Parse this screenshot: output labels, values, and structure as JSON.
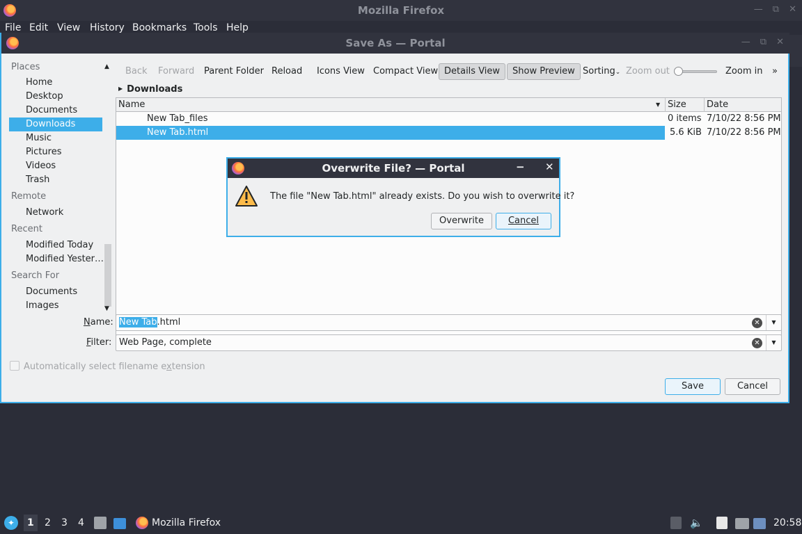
{
  "firefox": {
    "title": "Mozilla Firefox",
    "menu": [
      "File",
      "Edit",
      "View",
      "History",
      "Bookmarks",
      "Tools",
      "Help"
    ],
    "window_controls": [
      "—",
      "⧉",
      "✕"
    ]
  },
  "save_dialog": {
    "title": "Save As — Portal",
    "sidebar": {
      "groups": {
        "places": "Places",
        "remote": "Remote",
        "recent": "Recent",
        "search": "Search For"
      },
      "places_items": [
        "Home",
        "Desktop",
        "Documents",
        "Downloads",
        "Music",
        "Pictures",
        "Videos",
        "Trash"
      ],
      "remote_items": [
        "Network"
      ],
      "recent_items": [
        "Modified Today",
        "Modified Yester…"
      ],
      "search_items": [
        "Documents",
        "Images"
      ],
      "selected": "Downloads"
    },
    "toolbar": {
      "back": "Back",
      "forward": "Forward",
      "parent_folder": "Parent Folder",
      "reload": "Reload",
      "icons_view": "Icons View",
      "compact_view": "Compact View",
      "details_view": "Details View",
      "show_preview": "Show Preview",
      "sorting": "Sorting",
      "zoom_out": "Zoom out",
      "zoom_in": "Zoom in",
      "more": "»"
    },
    "breadcrumb": "Downloads",
    "columns": {
      "name": "Name",
      "size": "Size",
      "date": "Date"
    },
    "files": [
      {
        "name": "New Tab_files",
        "size": "0 items",
        "date": "7/10/22 8:56 PM",
        "selected": false
      },
      {
        "name": "New Tab.html",
        "size": "5.6 KiB",
        "date": "7/10/22 8:56 PM",
        "selected": true
      }
    ],
    "name_field": {
      "label_underlined": "N",
      "label_rest": "ame:",
      "value_selected": "New Tab",
      "value_rest": ".html"
    },
    "filter_field": {
      "label_underlined": "F",
      "label_rest": "ilter:",
      "value": "Web Page, complete"
    },
    "auto_ext_label_pre": "Automatically select filename e",
    "auto_ext_label_u": "x",
    "auto_ext_label_post": "tension",
    "save_label": "Save",
    "cancel_label": "Cancel"
  },
  "overwrite_dialog": {
    "title": "Overwrite File? — Portal",
    "message": "The file \"New Tab.html\" already exists. Do you wish to overwrite it?",
    "overwrite_label": "Overwrite",
    "cancel_label": "Cancel",
    "minimize": "−",
    "close": "✕"
  },
  "taskbar": {
    "workspaces": [
      "1",
      "2",
      "3",
      "4"
    ],
    "active_workspace": "1",
    "app_label": "Mozilla Firefox",
    "clock": "20:58"
  },
  "colors": {
    "accent": "#3daee9",
    "titlebar": "#31333e",
    "desktop": "#2b2d38"
  }
}
